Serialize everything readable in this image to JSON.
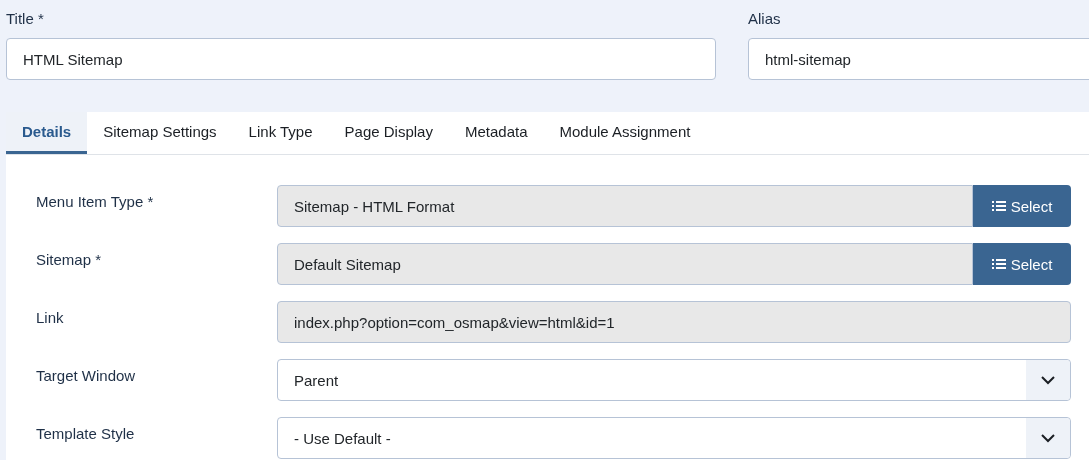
{
  "title_field": {
    "label": "Title *",
    "value": "HTML Sitemap"
  },
  "alias_field": {
    "label": "Alias",
    "value": "html-sitemap"
  },
  "tabs": [
    {
      "label": "Details",
      "selected": true
    },
    {
      "label": "Sitemap Settings",
      "selected": false
    },
    {
      "label": "Link Type",
      "selected": false
    },
    {
      "label": "Page Display",
      "selected": false
    },
    {
      "label": "Metadata",
      "selected": false
    },
    {
      "label": "Module Assignment",
      "selected": false
    }
  ],
  "fields": [
    {
      "kind": "picker",
      "label": "Menu Item Type *",
      "value": "Sitemap - HTML Format",
      "button": "Select"
    },
    {
      "kind": "picker",
      "label": "Sitemap *",
      "value": "Default Sitemap",
      "button": "Select"
    },
    {
      "kind": "readonly",
      "label": "Link",
      "value": "index.php?option=com_osmap&view=html&id=1"
    },
    {
      "kind": "select",
      "label": "Target Window",
      "value": "Parent"
    },
    {
      "kind": "select",
      "label": "Template Style",
      "value": "- Use Default -"
    }
  ]
}
